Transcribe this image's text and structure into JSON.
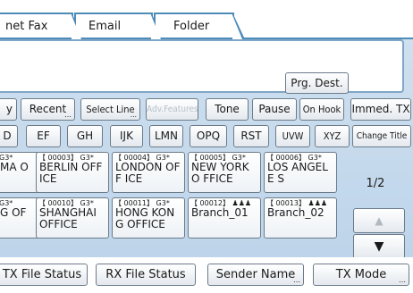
{
  "tabs": [
    {
      "label": "net Fax"
    },
    {
      "label": "Email"
    },
    {
      "label": "Folder"
    }
  ],
  "prg_dest": "Prg. Dest.",
  "functions": {
    "partial_left": "y",
    "recent": "Recent",
    "select_line": "Select Line",
    "adv_features": "Adv.Features",
    "tone": "Tone",
    "pause": "Pause",
    "on_hook": "On Hook",
    "immed_tx": "Immed. TX"
  },
  "index_tabs": {
    "partial_d": "D",
    "ef": "EF",
    "gh": "GH",
    "ijk": "IJK",
    "lmn": "LMN",
    "opq": "OPQ",
    "rst": "RST",
    "uvw": "UVW",
    "xyz": "XYZ",
    "change_title": "Change Title"
  },
  "destinations": [
    {
      "num": "G3*",
      "name": "MA O"
    },
    {
      "num": "【 00003】 G3*",
      "name": "BERLIN OFF ICE"
    },
    {
      "num": "【 00004】 G3*",
      "name": "LONDON OFF ICE"
    },
    {
      "num": "【 00005】 G3*",
      "name": "NEW YORK O FFICE"
    },
    {
      "num": "【 00006】 G3*",
      "name": "LOS ANGELE S"
    },
    {
      "num": "G3*",
      "name": "G OF"
    },
    {
      "num": "【 00010】 G3*",
      "name": "SHANGHAI OFFICE"
    },
    {
      "num": "【 00011】 G3*",
      "name": "HONG KONG OFFICE"
    },
    {
      "num": "【 00012】 ♟♟♟",
      "name": "Branch_01"
    },
    {
      "num": "【 00013】 ♟♟♟",
      "name": "Branch_02"
    }
  ],
  "page_indicator": "1/2",
  "scroll": {
    "up": "▲",
    "down": "▼"
  },
  "bottom": {
    "tx_file_status": "TX File Status",
    "rx_file_status": "RX File Status",
    "sender_name": "Sender Name",
    "tx_mode": "TX Mode"
  },
  "colors": {
    "accent": "#4d8bb8",
    "panel": "#c6d9ec"
  }
}
